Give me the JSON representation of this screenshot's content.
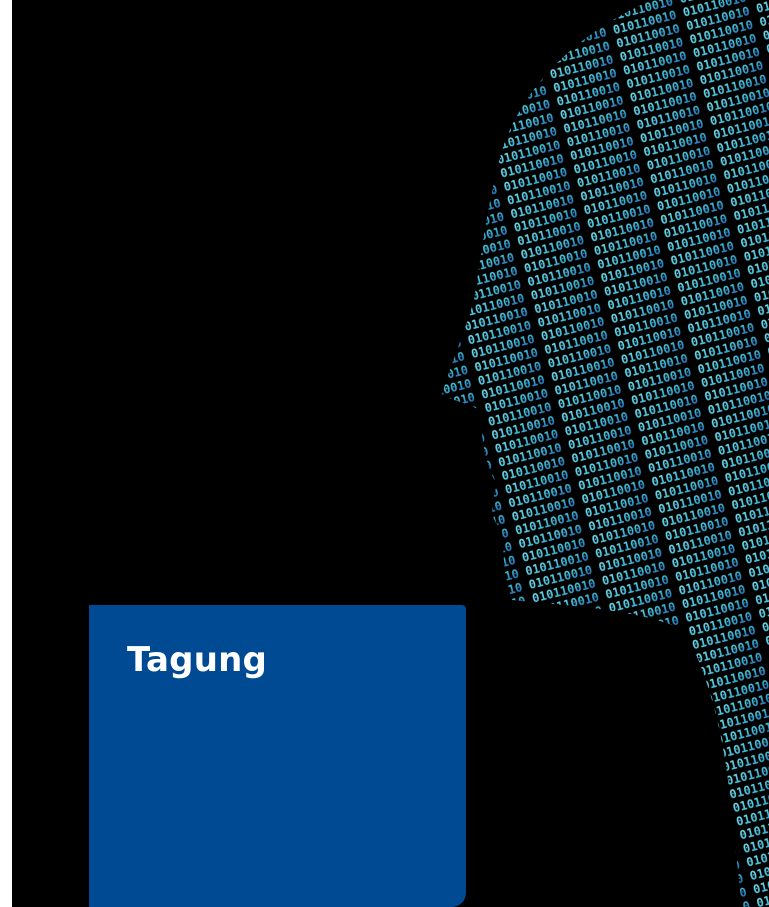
{
  "card": {
    "title": "Tagung"
  },
  "image": {
    "subject": "binary-digit-human-head-profile-icon"
  },
  "colors": {
    "background": "#000000",
    "card": "#004a93",
    "digits_light": "#5fd3e6",
    "digits_dark": "#1d5fb0"
  }
}
